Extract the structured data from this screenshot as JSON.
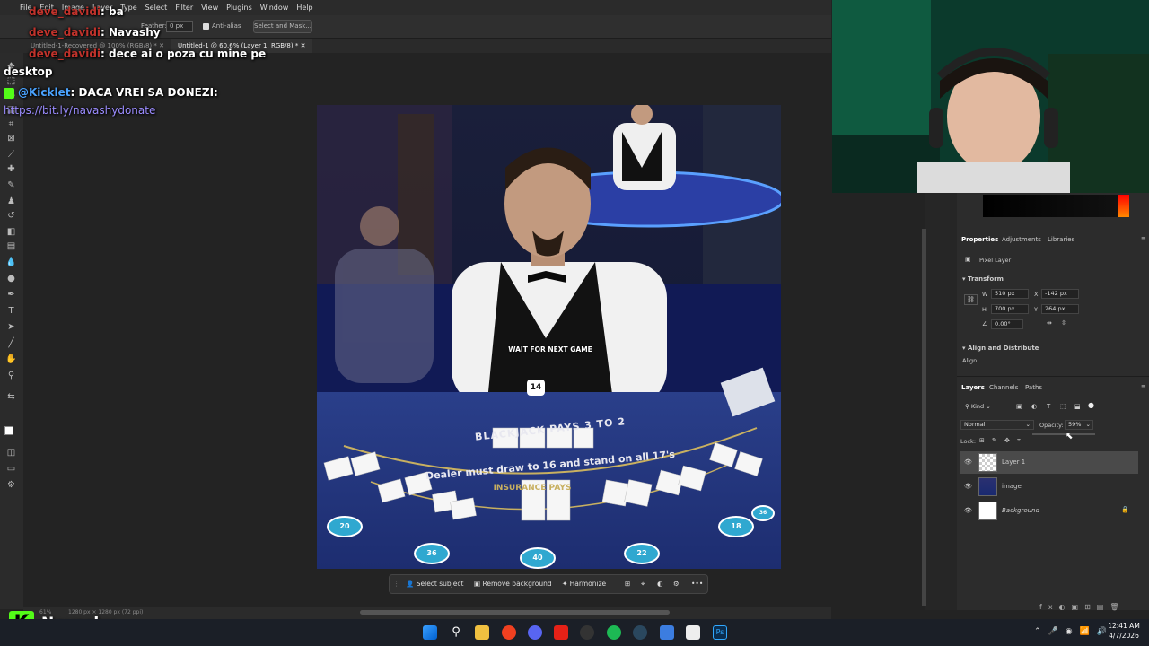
{
  "menu": [
    "File",
    "Edit",
    "Image",
    "Layer",
    "Type",
    "Select",
    "Filter",
    "View",
    "Plugins",
    "Window",
    "Help"
  ],
  "options": {
    "feather_label": "Feather:",
    "feather_value": "0 px",
    "antialias_label": "Anti-alias",
    "select_mask_label": "Select and Mask..."
  },
  "tabs": [
    {
      "label": "Untitled-1-Recovered @ 100% (RGB/8) *"
    },
    {
      "label": "Untitled-1 @ 60.6% (Layer 1, RGB/8) *"
    }
  ],
  "chat": [
    {
      "user": "deve_davidi",
      "text": ": ba"
    },
    {
      "user": "deve_davidi",
      "text": ": Navashy"
    },
    {
      "user": "deve_davidi",
      "text": ": dece ai o poza cu mine pe"
    },
    {
      "text": "desktop"
    },
    {
      "user": "@Kicklet",
      "text": ": DACA VREI SA DONEZI:"
    },
    {
      "text": "https://bit.ly/navashydonate"
    }
  ],
  "artwork": {
    "center_text": "WAIT FOR NEXT GAME",
    "badge": "14",
    "table_text": "BLACKJACK PAYS 3 TO 2",
    "arc_text": "Dealer must draw to 16 and stand on all 17's",
    "insurance": "INSURANCE PAYS",
    "chips": [
      "20",
      "36",
      "40",
      "22",
      "18",
      "36"
    ]
  },
  "context_bar": {
    "select_subject": "Select subject",
    "remove_background": "Remove background",
    "harmonize": "Harmonize",
    "more": "•••"
  },
  "status": {
    "zoom": "61%",
    "doc": "1280 px × 1280 px (72 ppi)"
  },
  "properties": {
    "tabs": [
      "Properties",
      "Adjustments",
      "Libraries"
    ],
    "kind": "Pixel Layer",
    "transform_label": "Transform",
    "w": "510 px",
    "x": "-142 px",
    "h": "700 px",
    "y": "264 px",
    "angle": "0.00°",
    "align_label": "Align and Distribute",
    "align_sub": "Align:"
  },
  "layers": {
    "tabs": [
      "Layers",
      "Channels",
      "Paths"
    ],
    "kind_filter": "Kind",
    "blend": "Normal",
    "opacity_label": "Opacity:",
    "opacity_value": "59%",
    "lock_label": "Lock:",
    "items": [
      {
        "name": "Layer 1",
        "selected": true
      },
      {
        "name": "image",
        "selected": false
      },
      {
        "name": "Background",
        "selected": false,
        "locked": true
      }
    ]
  },
  "brand": {
    "name": "Navashy"
  },
  "clock": {
    "time": "12:41 AM",
    "date": "4/7/2026"
  }
}
